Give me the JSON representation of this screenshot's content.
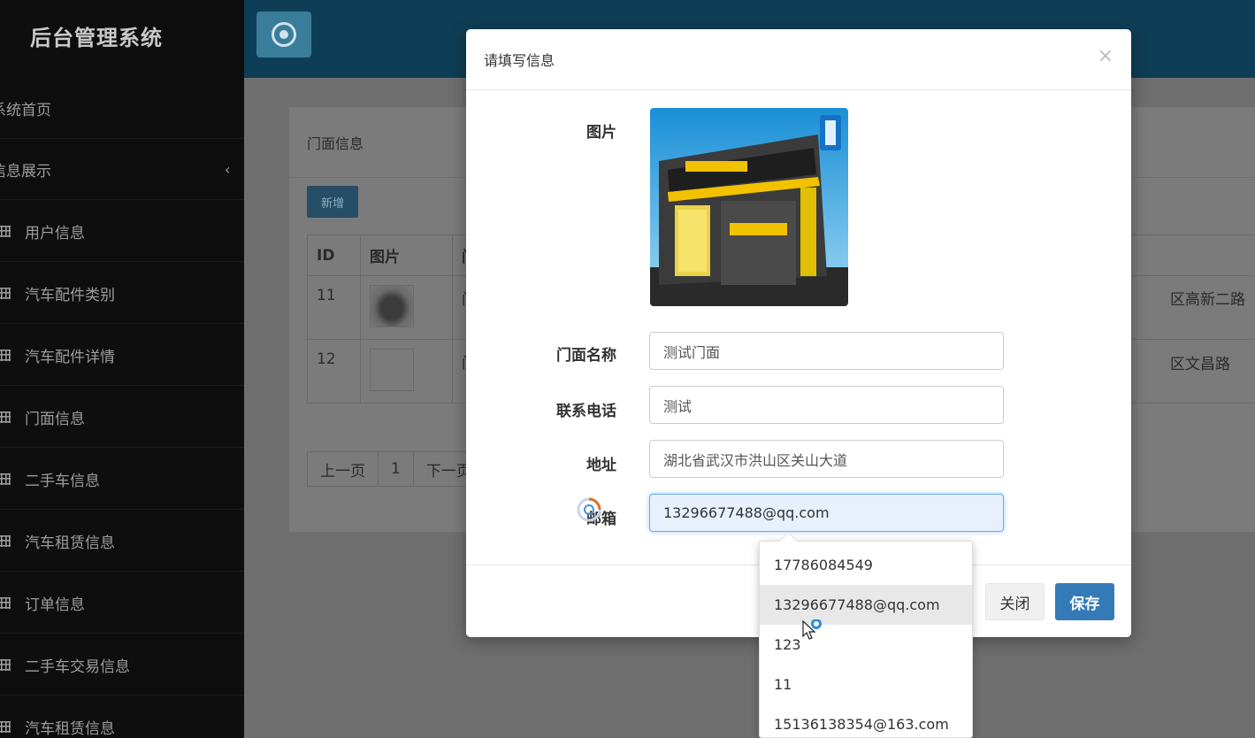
{
  "sidebar": {
    "brand": "后台管理系统",
    "items": [
      {
        "label": "系统首页"
      },
      {
        "label": "信息展示",
        "chevron": "‹"
      },
      {
        "label": "用户信息"
      },
      {
        "label": "汽车配件类别"
      },
      {
        "label": "汽车配件详情"
      },
      {
        "label": "门面信息"
      },
      {
        "label": "二手车信息"
      },
      {
        "label": "汽车租赁信息"
      },
      {
        "label": "订单信息"
      },
      {
        "label": "二手车交易信息"
      },
      {
        "label": "汽车租赁信息"
      }
    ]
  },
  "topbar": {
    "toggle_icon": "target-icon"
  },
  "panel": {
    "title": "门面信息",
    "add_label": "新增",
    "columns": [
      "ID",
      "图片",
      "门"
    ],
    "rows": [
      {
        "id": "11",
        "col3": "门",
        "addr": "区高新二路"
      },
      {
        "id": "12",
        "col3": "门",
        "addr": "区文昌路"
      }
    ],
    "pager": {
      "prev": "上一页",
      "page": "1",
      "next": "下一页"
    }
  },
  "modal": {
    "title": "请填写信息",
    "close": "×",
    "image_label": "图片",
    "name_label": "门面名称",
    "name_value": "测试门面",
    "phone_label": "联系电话",
    "phone_value": "测试",
    "address_label": "地址",
    "address_value": "湖北省武汉市洪山区关山大道",
    "email_label": "邮箱",
    "email_value": "13296677488@qq.com",
    "btn_close": "关闭",
    "btn_save": "保存"
  },
  "autocomplete": {
    "options": [
      "17786084549",
      "13296677488@qq.com",
      "123",
      "11",
      "15136138354@163.com"
    ],
    "highlighted": 1
  },
  "colors": {
    "sidebar_bg": "#0e0e0e",
    "topbar_bg": "#0e3e55",
    "primary": "#337ab7",
    "focus": "#66afe9"
  }
}
